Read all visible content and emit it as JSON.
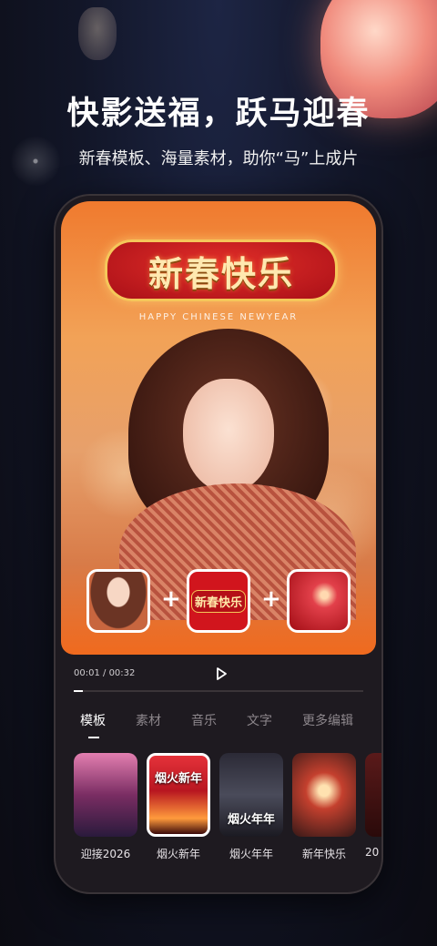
{
  "hero": {
    "title": "快影送福，跃马迎春",
    "subtitle": "新春模板、海量素材，助你“马”上成片"
  },
  "preview": {
    "banner_text": "新春快乐",
    "banner_sub": "HAPPY CHINESE NEWYEAR",
    "combo_thumb2_text": "新春快乐",
    "plus_symbol": "+"
  },
  "player": {
    "current_time": "00:01",
    "separator": " / ",
    "total_time": "00:32",
    "progress_fraction": 0.03
  },
  "tabs": [
    {
      "label": "模板",
      "active": true
    },
    {
      "label": "素材",
      "active": false
    },
    {
      "label": "音乐",
      "active": false
    },
    {
      "label": "文字",
      "active": false
    },
    {
      "label": "更多编辑",
      "active": false
    }
  ],
  "templates": [
    {
      "label": "迎接2026",
      "overlay": ""
    },
    {
      "label": "烟火新年",
      "overlay": "烟火新年",
      "selected": true
    },
    {
      "label": "烟火年年",
      "overlay": "烟火年年"
    },
    {
      "label": "新年快乐",
      "overlay": "新年快乐"
    },
    {
      "label": "20",
      "overlay": ""
    }
  ],
  "colors": {
    "accent_orange": "#f07a2e",
    "banner_red": "#d1151d",
    "banner_gold": "#f5c75a"
  }
}
